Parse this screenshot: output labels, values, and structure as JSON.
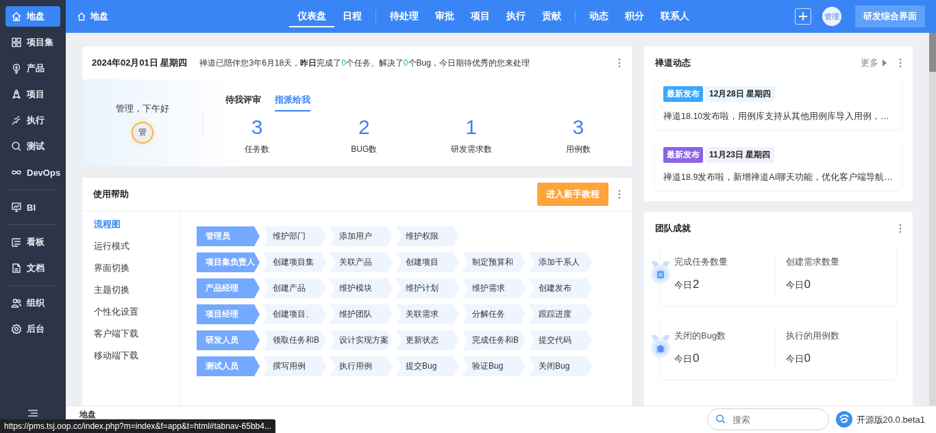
{
  "sidebar": {
    "items": [
      {
        "label": "地盘",
        "selected": true
      },
      {
        "label": "项目集",
        "selected": false
      },
      {
        "label": "产品",
        "selected": false
      },
      {
        "label": "项目",
        "selected": false
      },
      {
        "label": "执行",
        "selected": false
      },
      {
        "label": "测试",
        "selected": false
      },
      {
        "label": "DevOps",
        "selected": false
      },
      {
        "label": "BI",
        "selected": false,
        "divider_before": true
      },
      {
        "label": "看板",
        "selected": false,
        "divider_before": true
      },
      {
        "label": "文档",
        "selected": false
      },
      {
        "label": "组织",
        "selected": false,
        "divider_before": true
      },
      {
        "label": "后台",
        "selected": false
      }
    ]
  },
  "topbar": {
    "title": "地盘",
    "nav": [
      {
        "label": "仪表盘",
        "selected": true
      },
      {
        "label": "日程",
        "selected": false
      },
      {
        "label": "待处理",
        "selected": false,
        "divider_before": true
      },
      {
        "label": "审批",
        "selected": false
      },
      {
        "label": "项目",
        "selected": false
      },
      {
        "label": "执行",
        "selected": false
      },
      {
        "label": "贡献",
        "selected": false
      },
      {
        "label": "动态",
        "selected": false,
        "divider_before": true
      },
      {
        "label": "积分",
        "selected": false
      },
      {
        "label": "联系人",
        "selected": false
      }
    ],
    "avatar_text": "管理",
    "switch_button": "研发综合界面"
  },
  "welcome": {
    "date": "2024年02月01日 星期四",
    "message": [
      {
        "kind": "plain",
        "text": "禅道已陪伴您3年6月18天，"
      },
      {
        "kind": "bold",
        "text": "昨日"
      },
      {
        "kind": "plain",
        "text": "完成了"
      },
      {
        "kind": "count",
        "text": "0"
      },
      {
        "kind": "plain",
        "text": "个任务、解决了"
      },
      {
        "kind": "count",
        "text": "0"
      },
      {
        "kind": "plain",
        "text": "个Bug，今日期待优秀的您来处理"
      }
    ],
    "greeting": "管理，下午好",
    "avatar_text": "管",
    "tabs": [
      {
        "label": "待我评审",
        "selected": false
      },
      {
        "label": "指派给我",
        "selected": true
      }
    ],
    "stats": [
      {
        "value": "3",
        "label": "任务数"
      },
      {
        "value": "2",
        "label": "BUG数"
      },
      {
        "value": "1",
        "label": "研发需求数"
      },
      {
        "value": "3",
        "label": "用例数"
      }
    ]
  },
  "help": {
    "title": "使用帮助",
    "tutorial_button": "进入新手教程",
    "menu": [
      {
        "label": "流程图",
        "selected": true
      },
      {
        "label": "运行模式",
        "selected": false
      },
      {
        "label": "界面切换",
        "selected": false
      },
      {
        "label": "主题切换",
        "selected": false
      },
      {
        "label": "个性化设置",
        "selected": false
      },
      {
        "label": "客户端下载",
        "selected": false
      },
      {
        "label": "移动端下载",
        "selected": false
      }
    ],
    "flow": [
      {
        "role": "管理员",
        "steps": [
          "维护部门",
          "添加用户",
          "维护权限"
        ]
      },
      {
        "role": "项目集负责人",
        "steps": [
          "创建项目集",
          "关联产品",
          "创建项目",
          "制定预算和",
          "添加干系人"
        ]
      },
      {
        "role": "产品经理",
        "steps": [
          "创建产品",
          "维护模块",
          "维护计划",
          "维护需求",
          "创建发布"
        ]
      },
      {
        "role": "项目经理",
        "steps": [
          "创建项目、",
          "维护团队",
          "关联需求",
          "分解任务",
          "跟踪进度"
        ]
      },
      {
        "role": "研发人员",
        "steps": [
          "领取任务和B",
          "设计实现方案",
          "更新状态",
          "完成任务和B",
          "提交代码"
        ]
      },
      {
        "role": "测试人员",
        "steps": [
          "撰写用例",
          "执行用例",
          "提交Bug",
          "验证Bug",
          "关闭Bug"
        ]
      }
    ]
  },
  "news": {
    "title": "禅道动态",
    "more": "更多",
    "items": [
      {
        "tag": "最新发布",
        "color": "#3aa8fb",
        "date": "12月28日 星期四",
        "text": "禅道18.10发布啦，用例库支持从其他用例库导入用例，…"
      },
      {
        "tag": "最新发布",
        "color": "#8a63e8",
        "date": "11月23日 星期四",
        "text": "禅道18.9发布啦，新增禅道AI聊天功能，优化客户端导航…"
      }
    ]
  },
  "team": {
    "title": "团队成就",
    "cards": [
      {
        "metrics": [
          {
            "label": "完成任务数量",
            "prefix": "今日",
            "value": "2"
          },
          {
            "label": "创建需求数量",
            "prefix": "今日",
            "value": "0"
          }
        ]
      },
      {
        "metrics": [
          {
            "label": "关闭的Bug数",
            "prefix": "今日",
            "value": "0"
          },
          {
            "label": "执行的用例数",
            "prefix": "今日",
            "value": "0"
          }
        ]
      }
    ]
  },
  "footer": {
    "breadcrumb": "地盘",
    "search_placeholder": "搜索",
    "version": "开源版20.0.beta1"
  },
  "status_url": "https://pms.tsj.oop.cc/index.php?m=index&f=app&t=html#tabnav-65bb4..."
}
